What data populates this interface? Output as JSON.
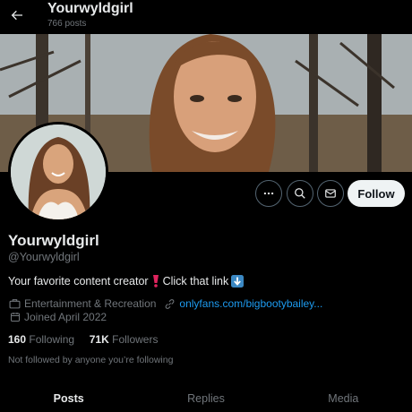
{
  "header": {
    "title": "Yourwyldgirl",
    "post_count": "766 posts"
  },
  "actions": {
    "follow_label": "Follow"
  },
  "profile": {
    "name": "Yourwyldgirl",
    "handle": "@Yourwyldgirl",
    "bio_text": "Your favorite content creator",
    "bio_text_2": "Click that link",
    "category": "Entertainment & Recreation",
    "link": "onlyfans.com/bigbootybailey...",
    "joined": "Joined April 2022"
  },
  "stats": {
    "following_count": "160",
    "following_label": "Following",
    "followers_count": "71K",
    "followers_label": "Followers"
  },
  "not_followed_note": "Not followed by anyone you’re following",
  "tabs": [
    {
      "label": "Posts"
    },
    {
      "label": "Replies"
    },
    {
      "label": "Media"
    }
  ],
  "colors": {
    "accent": "#1d9bf0",
    "bg": "#000000",
    "muted": "#71767b"
  }
}
